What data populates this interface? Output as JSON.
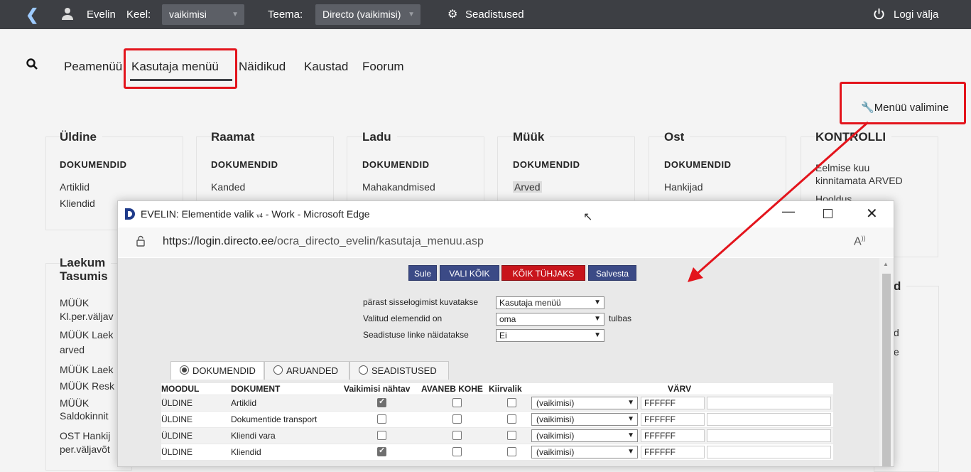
{
  "topbar": {
    "user": "Evelin",
    "lang_label": "Keel:",
    "lang_value": "vaikimisi",
    "theme_label": "Teema:",
    "theme_value": "Directo (vaikimisi)",
    "settings": "Seadistused",
    "logout": "Logi välja"
  },
  "nav": {
    "tabs": [
      "Peamenüü",
      "Kasutaja menüü",
      "Näidikud",
      "Kaustad",
      "Foorum"
    ],
    "active": "Kasutaja menüü"
  },
  "menu_select": "Menüü valimine",
  "cards": [
    {
      "title": "Üldine",
      "sub": "DOKUMENDID",
      "links": [
        "Artiklid",
        "Kliendid"
      ]
    },
    {
      "title": "Raamat",
      "sub": "DOKUMENDID",
      "links": [
        "Kanded"
      ]
    },
    {
      "title": "Ladu",
      "sub": "DOKUMENDID",
      "links": [
        "Mahakandmised"
      ]
    },
    {
      "title": "Müük",
      "sub": "DOKUMENDID",
      "links": [
        "Arved"
      ]
    },
    {
      "title": "Ost",
      "sub": "DOKUMENDID",
      "links": [
        "Hankijad"
      ]
    },
    {
      "title": "KONTROLLI",
      "sub": "",
      "links": [
        "Eelmise kuu",
        "kinnitamata ARVED",
        "Hooldus"
      ]
    }
  ],
  "left_card": {
    "title_1": "Laekum",
    "title_2": "Tasumis",
    "links": [
      "MÜÜK",
      "Kl.per.väljav",
      "MÜÜK Laek",
      "arved",
      "MÜÜK Laek",
      "MÜÜK Resk",
      "MÜÜK",
      "Saldokinnit",
      "OST Hankij",
      "per.väljavõt"
    ]
  },
  "right_card": {
    "title": "d",
    "links": [
      "d",
      "e"
    ]
  },
  "popup": {
    "title_prefix": "EVELIN: Elementide valik",
    "title_sub": "v4",
    "title_suffix": "- Work - Microsoft Edge",
    "url_host": "https://login.directo.ee",
    "url_path": "/ocra_directo_evelin/kasutaja_menuu.asp",
    "read_aloud": "A",
    "buttons": {
      "close": "Sule",
      "select_all": "VALI KÕIK",
      "clear_all": "KÕIK TÜHJAKS",
      "save": "Salvesta"
    },
    "fields": {
      "after_login_label": "pärast sisselogimist kuvatakse",
      "after_login_value": "Kasutaja menüü",
      "elements_label": "Valitud elemendid on",
      "elements_value": "oma",
      "elements_suffix": "tulbas",
      "links_label": "Seadistuse linke näidatakse",
      "links_value": "Ei"
    },
    "tabs": [
      "DOKUMENDID",
      "ARUANDED",
      "SEADISTUSED"
    ],
    "table_headers": {
      "module": "MOODUL",
      "document": "DOKUMENT",
      "default": "Vaikimisi nähtav",
      "opens": "AVANEB KOHE",
      "shortcut": "Kiirvalik",
      "color": "VÄRV"
    },
    "rows": [
      {
        "module": "ÜLDINE",
        "doc": "Artiklid",
        "visible": true,
        "opens": false,
        "quick": false,
        "select": "(vaikimisi)",
        "color": "FFFFFF"
      },
      {
        "module": "ÜLDINE",
        "doc": "Dokumentide transport",
        "visible": false,
        "opens": false,
        "quick": false,
        "select": "(vaikimisi)",
        "color": "FFFFFF"
      },
      {
        "module": "ÜLDINE",
        "doc": "Kliendi vara",
        "visible": false,
        "opens": false,
        "quick": false,
        "select": "(vaikimisi)",
        "color": "FFFFFF"
      },
      {
        "module": "ÜLDINE",
        "doc": "Kliendid",
        "visible": true,
        "opens": false,
        "quick": false,
        "select": "(vaikimisi)",
        "color": "FFFFFF"
      }
    ]
  },
  "colors": {
    "topbar": "#3d3f44",
    "highlight": "#e3141c",
    "btn_blue": "#3b4a86",
    "btn_red": "#c8141b"
  }
}
